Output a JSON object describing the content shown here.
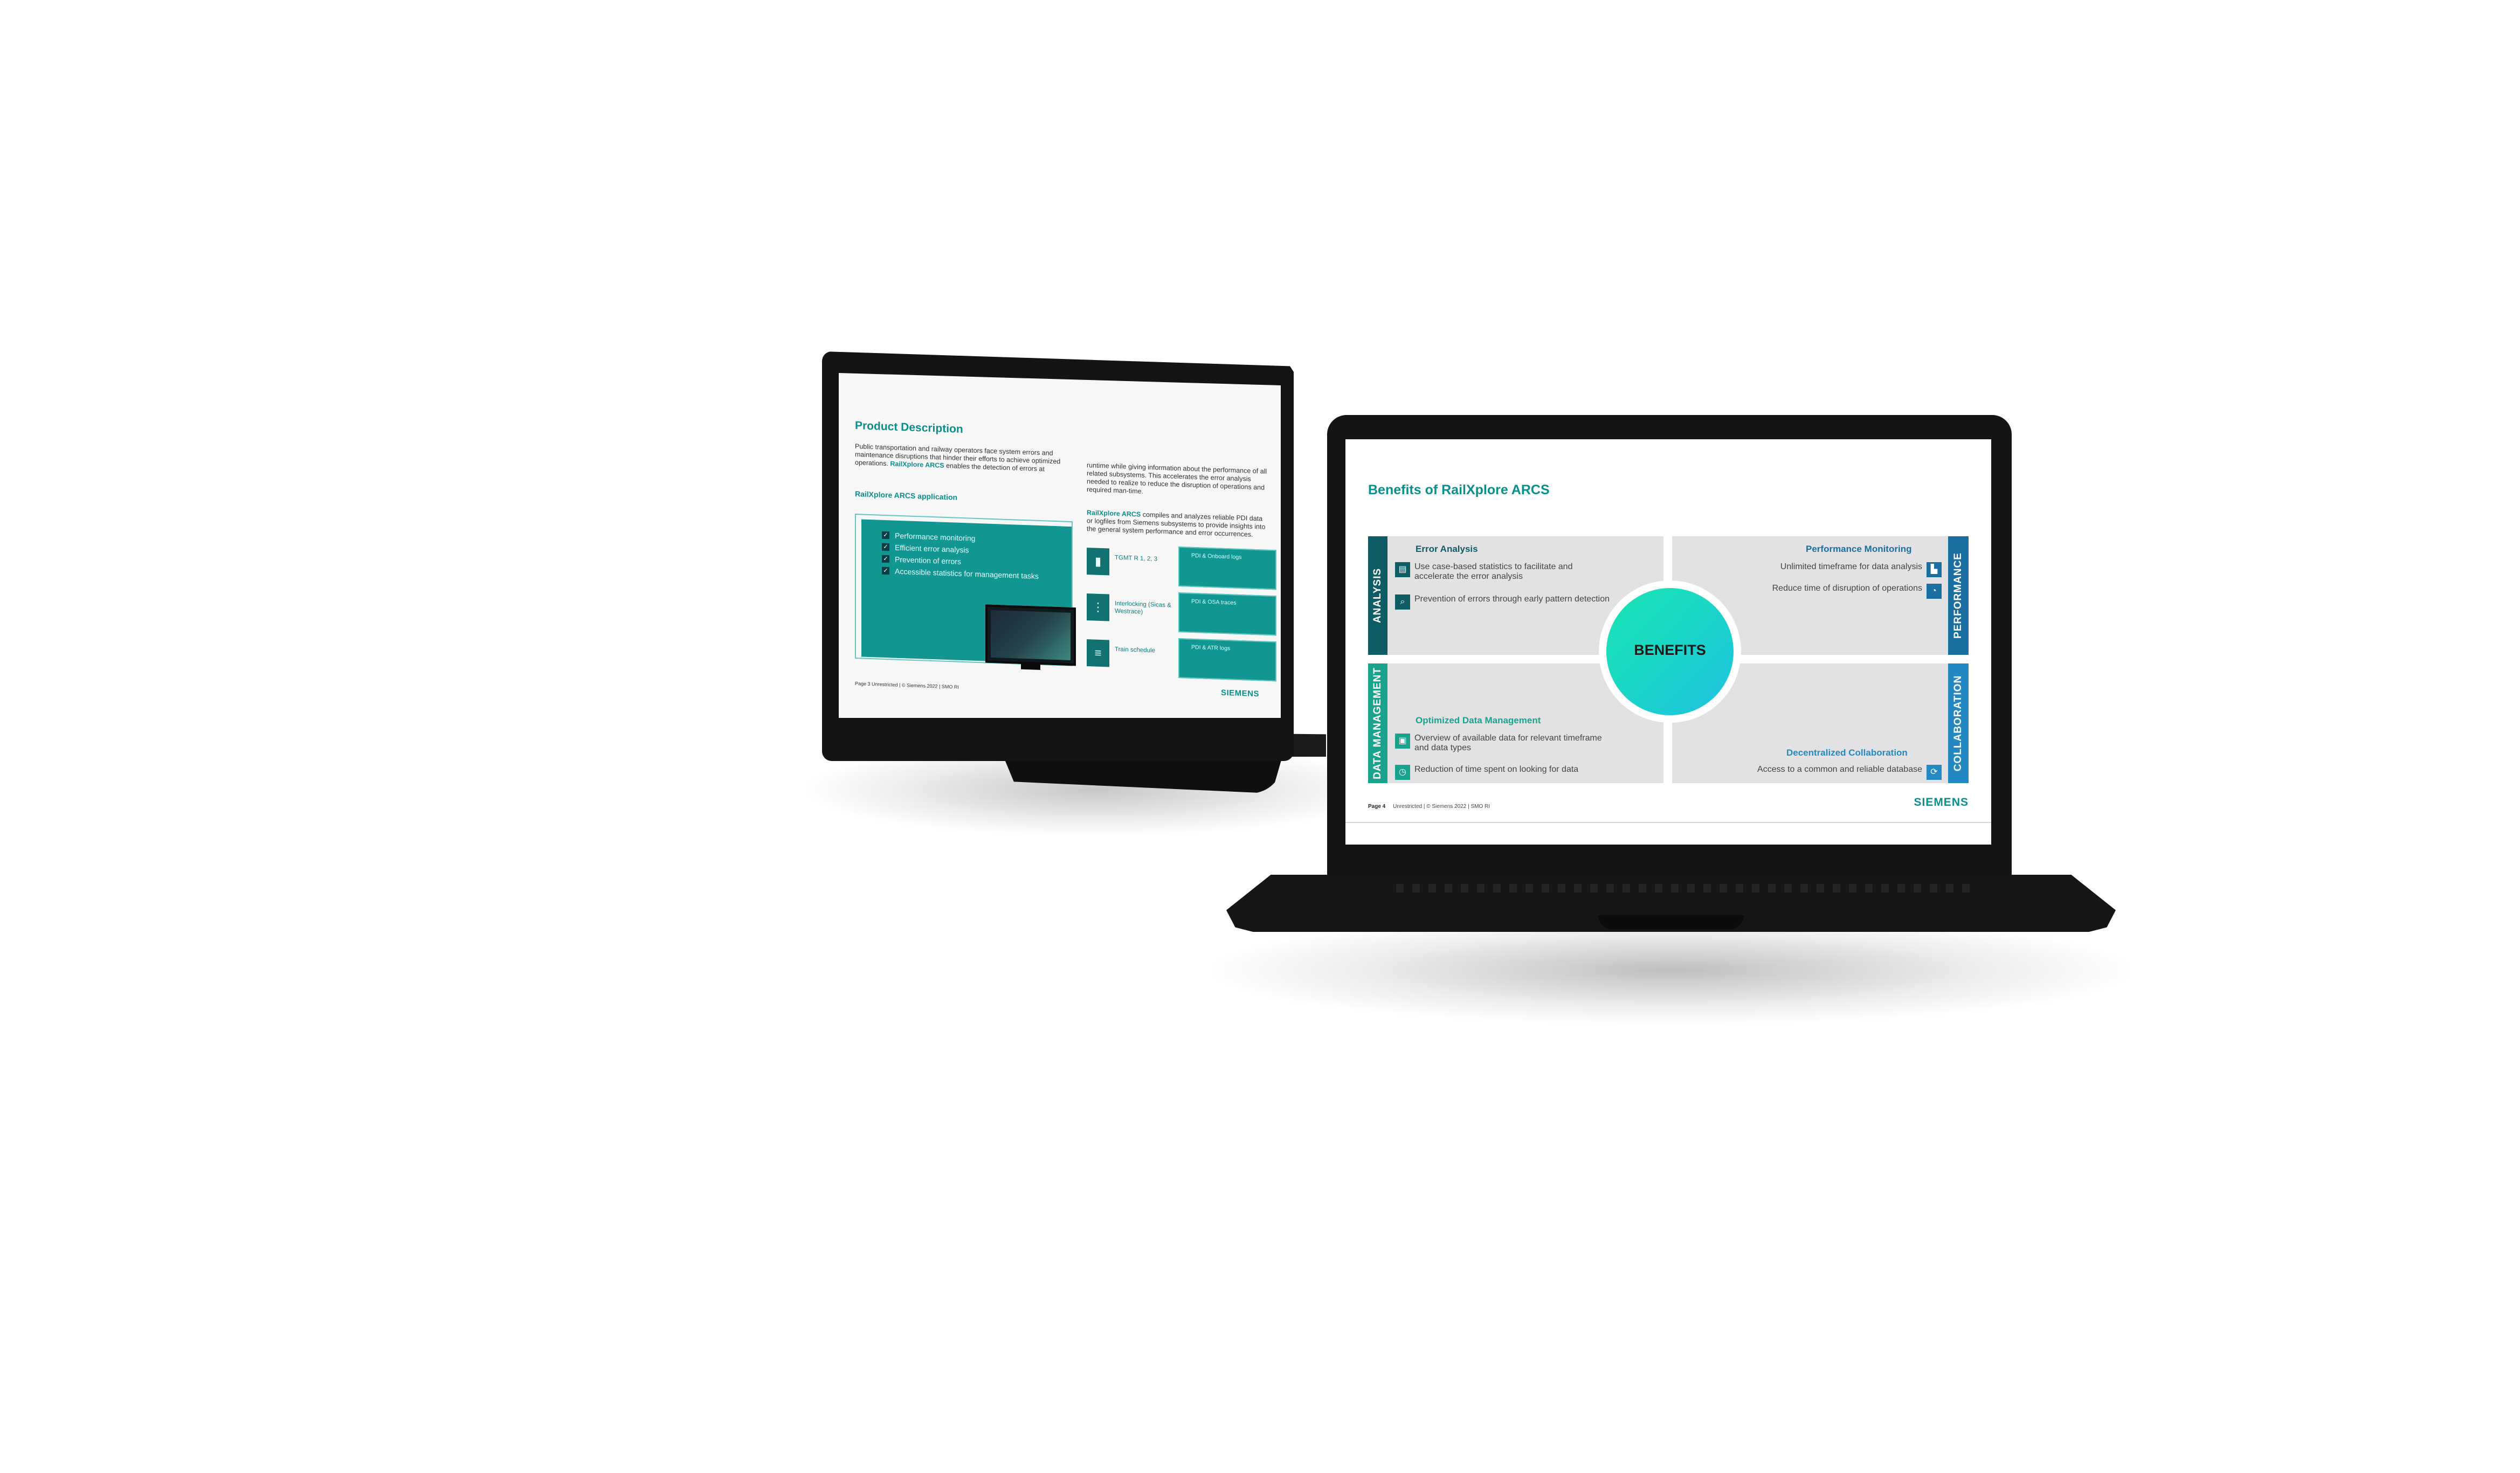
{
  "back_slide": {
    "title": "Product Description",
    "intro": "Public transportation and railway operators face system errors and maintenance disruptions that hinder their efforts to achieve optimized operations.",
    "intro_highlight": "RailXplore ARCS",
    "intro_tail": "enables the detection of errors at",
    "application_title": "RailXplore ARCS application",
    "checklist": [
      "Performance monitoring",
      "Efficient error analysis",
      "Prevention of errors",
      "Accessible statistics for management tasks"
    ],
    "right_para": "runtime while giving information about the performance of all related subsystems. This accelerates the error analysis needed to realize to reduce the disruption of operations and required man-time.",
    "right_para2_highlight": "RailXplore ARCS",
    "right_para2": "compiles and analyzes reliable PDI data or logfiles from Siemens subsystems to provide insights into the general system performance and error occurrences.",
    "rows": [
      {
        "icon": "train-icon",
        "label": "TGMT R 1, 2, 3",
        "box": "PDI & Onboard logs"
      },
      {
        "icon": "interlocking-icon",
        "label": "Interlocking (Sicas & Westrace)",
        "box": "PDI & OSA traces"
      },
      {
        "icon": "schedule-icon",
        "label": "Train schedule",
        "box": "PDI & ATR logs"
      }
    ],
    "footer": "Page 3     Unrestricted | © Siemens 2022 | SMO RI",
    "logo": "SIEMENS"
  },
  "front_slide": {
    "title": "Benefits of RailXplore ARCS",
    "center_label": "BENEFITS",
    "bands": {
      "analysis": "ANALYSIS",
      "performance": "PERFORMANCE",
      "data_management": "DATA MANAGEMENT",
      "collaboration": "COLLABORATION"
    },
    "quadrants": {
      "error_analysis": {
        "heading": "Error Analysis",
        "items": [
          "Use case-based statistics to facilitate and accelerate the error analysis",
          "Prevention of errors through early pattern detection"
        ]
      },
      "performance_monitoring": {
        "heading": "Performance Monitoring",
        "items": [
          "Unlimited timeframe for data analysis",
          "Reduce time of disruption of operations"
        ]
      },
      "optimized_data_management": {
        "heading": "Optimized Data Management",
        "items": [
          "Overview of available data for relevant timeframe and data types",
          "Reduction of time spent on looking for data"
        ]
      },
      "decentralized_collaboration": {
        "heading": "Decentralized Collaboration",
        "items": [
          "Access to a common and reliable database"
        ]
      }
    },
    "footer_page": "Page 4",
    "footer_text": "Unrestricted | © Siemens 2022 | SMO RI",
    "logo": "SIEMENS"
  },
  "colors": {
    "teal": "#0a8f8c",
    "dark_teal_band": "#0d5c66",
    "green_band": "#1aa38c",
    "blue_band": "#1b6fa0",
    "light_blue_band": "#2489c2",
    "quadrant_gray": "#e2e2e5"
  }
}
